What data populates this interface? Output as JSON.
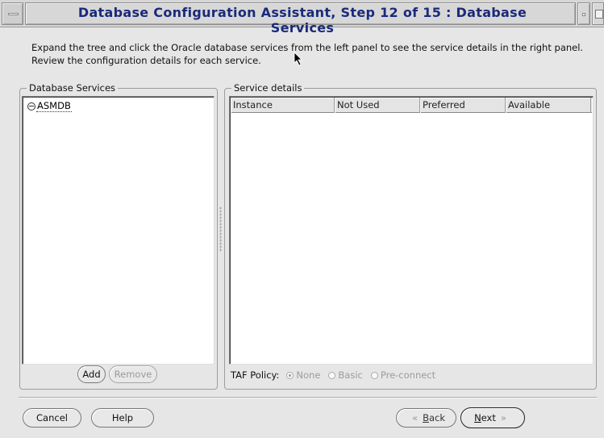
{
  "window": {
    "title": "Database Configuration Assistant, Step 12 of 15 : Database Services"
  },
  "description": {
    "line1": "Expand the tree and click the Oracle database services from the left panel to see the service details in the right panel.",
    "line2": "Review the configuration details for each service."
  },
  "database_services": {
    "group_title": "Database Services",
    "tree": [
      {
        "label": "ASMDB",
        "expanded": true
      }
    ],
    "add_label": "Add",
    "remove_label": "Remove"
  },
  "service_details": {
    "group_title": "Service details",
    "columns": [
      "Instance",
      "Not Used",
      "Preferred",
      "Available"
    ],
    "rows": [],
    "taf_policy": {
      "label": "TAF Policy:",
      "options": [
        "None",
        "Basic",
        "Pre-connect"
      ],
      "selected": "None"
    }
  },
  "footer": {
    "cancel_label": "Cancel",
    "help_label": "Help",
    "back_label": "Back",
    "back_mnemonic": "B",
    "back_rest": "ack",
    "next_label": "Next",
    "next_mnemonic": "N",
    "next_rest": "ext",
    "back_arrow": "«",
    "next_arrow": "»"
  },
  "icons": {
    "window_menu": "window-menu-icon",
    "minimize": "minimize-icon",
    "maximize": "maximize-icon",
    "tree_expand": "tree-collapse-icon",
    "cursor": "mouse-pointer-icon"
  }
}
